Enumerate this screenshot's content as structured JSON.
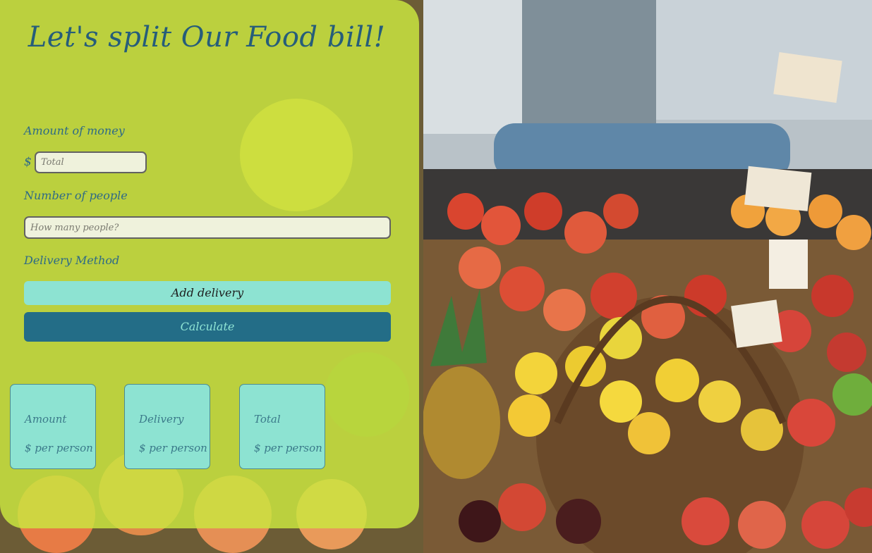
{
  "title": "Let's split Our Food bill!",
  "form": {
    "amount_label": "Amount of money",
    "currency_symbol": "$",
    "total_placeholder": "Total",
    "people_label": "Number of people",
    "people_placeholder": "How many people?",
    "delivery_label": "Delivery Method",
    "add_delivery_button": "Add delivery",
    "calculate_button": "Calculate"
  },
  "results": [
    {
      "title": "Amount",
      "value": "$ per person"
    },
    {
      "title": "Delivery",
      "value": "$ per person"
    },
    {
      "title": "Total",
      "value": "$ per person"
    }
  ],
  "colors": {
    "panel": "#cbe640",
    "title": "#265d7a",
    "accent_button": "#8de3d2",
    "primary_button": "#236d87"
  },
  "background": {
    "description_icon": "fruit-market-photo"
  }
}
